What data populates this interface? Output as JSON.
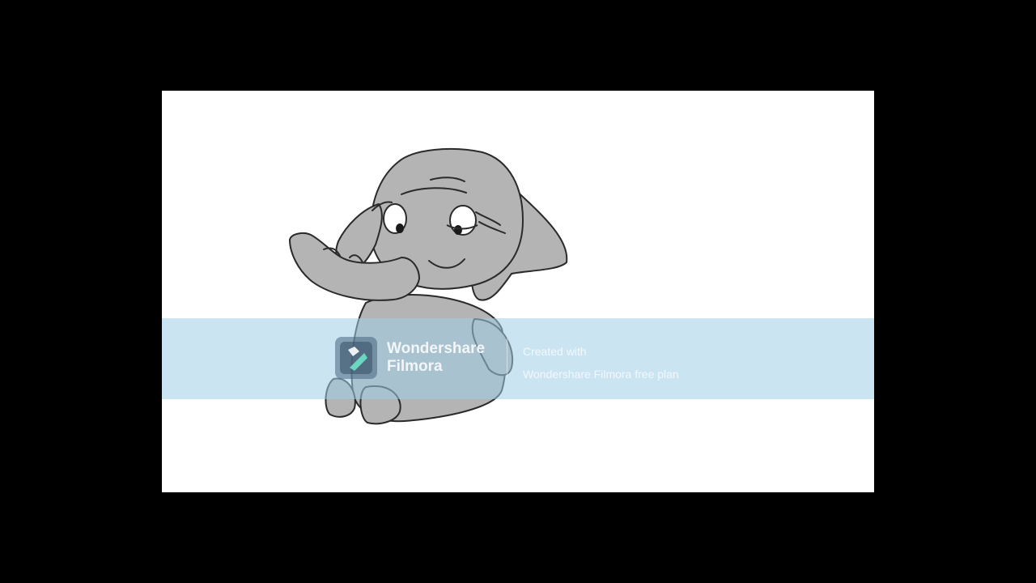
{
  "watermark": {
    "brand_line1": "Wondershare",
    "brand_line2": "Filmora",
    "created_with": "Created with",
    "plan": "Wondershare Filmora free plan",
    "logo_icon": "filmora-logo-icon"
  },
  "colors": {
    "letterbox": "#000000",
    "frame_background": "#ffffff",
    "elephant_body": "#b4b4b4",
    "elephant_outline": "#2a2a2a",
    "watermark_band": "#a0cde8",
    "logo_accent": "#6fdcc4"
  }
}
